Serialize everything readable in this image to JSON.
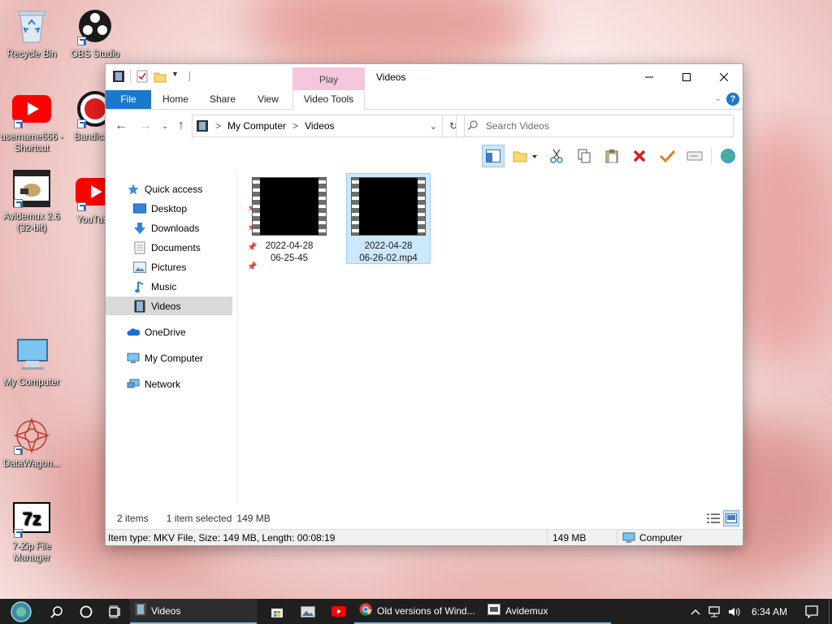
{
  "desktop": {
    "icons": [
      {
        "label": "Recycle Bin",
        "icon": "recycle-bin-icon"
      },
      {
        "label": "OBS Studio",
        "icon": "obs-studio-icon"
      },
      {
        "label": "username666 - Shortcut",
        "icon": "youtube-icon"
      },
      {
        "label": "Bandicam",
        "icon": "bandicam-icon"
      },
      {
        "label": "Avidemux 2.6 (32-bit)",
        "icon": "avidemux-icon"
      },
      {
        "label": "YouTube",
        "icon": "youtube-icon"
      },
      {
        "label": "My Computer",
        "icon": "computer-icon"
      },
      {
        "label": "DataWagon...",
        "icon": "datawagon-icon"
      },
      {
        "label": "7-Zip File Manager",
        "icon": "7zip-icon"
      }
    ]
  },
  "window": {
    "title": "Videos",
    "contextual_tab_header": "Play",
    "tabs": {
      "file": "File",
      "home": "Home",
      "share": "Share",
      "view": "View",
      "video_tools": "Video Tools"
    },
    "address": {
      "segments": [
        "My Computer",
        "Videos"
      ],
      "separator": ">"
    },
    "search": {
      "placeholder": "Search Videos"
    },
    "nav": {
      "quick_access": "Quick access",
      "items": [
        "Desktop",
        "Downloads",
        "Documents",
        "Pictures",
        "Music",
        "Videos"
      ],
      "onedrive": "OneDrive",
      "my_computer": "My Computer",
      "network": "Network"
    },
    "files": [
      {
        "line1": "2022-04-28",
        "line2": "06-25-45",
        "selected": false
      },
      {
        "line1": "2022-04-28",
        "line2": "06-26-02.mp4",
        "selected": true
      }
    ],
    "status": {
      "items_count": "2 items",
      "selection": "1 item selected",
      "selection_size": "149 MB"
    },
    "statusbar": {
      "info": "Item type: MKV File, Size: 149 MB, Length: 00:08:19",
      "size": "149 MB",
      "location": "Computer"
    }
  },
  "taskbar": {
    "tasks": [
      {
        "label": "Videos",
        "active": true
      },
      {
        "label": "Old versions of Wind...",
        "active": false
      },
      {
        "label": "Avidemux",
        "active": false
      }
    ],
    "clock": "6:34 AM"
  },
  "colors": {
    "accent": "#1979ca",
    "selection": "#cce8ff",
    "play_tab": "#f6c6de",
    "taskbar": "#1f1f1f"
  }
}
